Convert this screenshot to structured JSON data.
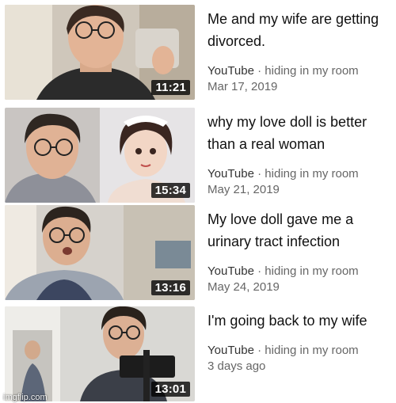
{
  "videos": [
    {
      "title": "Me and my wife are getting divorced.",
      "channel": "YouTube",
      "separator": "·",
      "subtitle": "hiding in my room",
      "date": "Mar 17, 2019",
      "duration": "11:21"
    },
    {
      "title": "why my love doll is better than a real woman",
      "channel": "YouTube",
      "separator": "·",
      "subtitle": "hiding in my room",
      "date": "May 21, 2019",
      "duration": "15:34"
    },
    {
      "title": "My love doll gave me a urinary tract infection",
      "channel": "YouTube",
      "separator": "·",
      "subtitle": "hiding in my room",
      "date": "May 24, 2019",
      "duration": "13:16"
    },
    {
      "title": "I'm going back to my wife",
      "channel": "YouTube",
      "separator": "·",
      "subtitle": "hiding in my room",
      "date": "3 days ago",
      "duration": "13:01"
    }
  ],
  "watermark": "imgflip.com"
}
